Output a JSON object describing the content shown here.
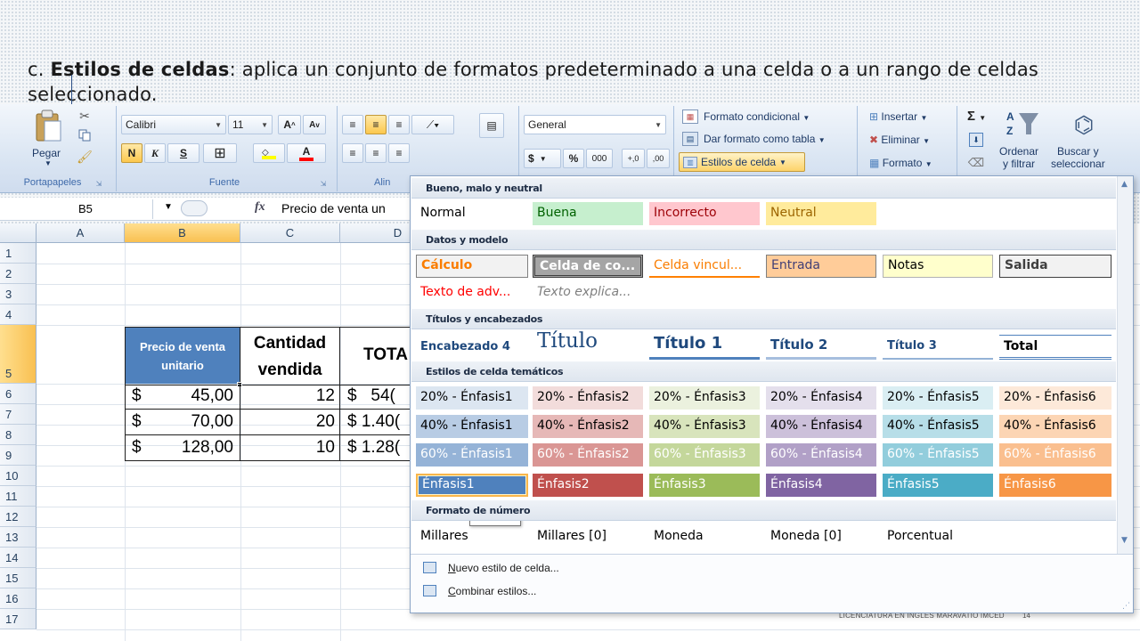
{
  "caption": {
    "prefix": "c. ",
    "bold": "Estilos de celdas",
    "rest": ": aplica un conjunto de formatos predeterminado a una celda o a un rango de celdas seleccionado."
  },
  "ribbon": {
    "clipboard": {
      "paste": "Pegar",
      "group": "Portapapeles"
    },
    "font": {
      "name": "Calibri",
      "size": "11",
      "bold": "N",
      "italic": "K",
      "underline": "S",
      "group": "Fuente"
    },
    "alignment": {
      "group": "Alin"
    },
    "number": {
      "format": "General",
      "currency": "$",
      "percent": "%",
      "thousands": "000",
      "inc_dec": "+,0",
      "dec_dec": ",00"
    },
    "styles": {
      "conditional": "Formato condicional",
      "as_table": "Dar formato como tabla",
      "cell_styles": "Estilos de celda"
    },
    "cells": {
      "insert": "Insertar",
      "delete": "Eliminar",
      "format": "Formato"
    },
    "editing": {
      "sigma": "Σ",
      "sort_1": "Ordenar",
      "sort_2": "y filtrar",
      "find_1": "Buscar y",
      "find_2": "seleccionar"
    }
  },
  "formula_bar": {
    "name_box": "B5",
    "fx": "fx",
    "content": "Precio de venta un"
  },
  "grid": {
    "columns": [
      "A",
      "B",
      "C",
      "D"
    ],
    "rows": [
      "1",
      "2",
      "3",
      "4",
      "5",
      "6",
      "7",
      "8",
      "9",
      "10",
      "11",
      "12",
      "13",
      "14",
      "15",
      "16",
      "17"
    ],
    "header_b": "Precio de venta unitario",
    "header_c_1": "Cantidad",
    "header_c_2": "vendida",
    "header_d": "TOTA",
    "data": [
      {
        "sign": "$",
        "price": "45,00",
        "qty": "12",
        "total": "$   54("
      },
      {
        "sign": "$",
        "price": "70,00",
        "qty": "20",
        "total": "$ 1.40("
      },
      {
        "sign": "$",
        "price": "128,00",
        "qty": "10",
        "total": "$ 1.28("
      }
    ],
    "footer_note": "LICENCIATURA EN INGLES MARAVATIO IMCED",
    "page_number": "14"
  },
  "panel": {
    "sections": [
      "Bueno, malo y neutral",
      "Datos y modelo",
      "Títulos y encabezados",
      "Estilos de celda temáticos",
      "Formato de número"
    ],
    "good_bad": [
      "Normal",
      "Buena",
      "Incorrecto",
      "Neutral"
    ],
    "data_model_1": [
      "Cálculo",
      "Celda de co...",
      "Celda vincul...",
      "Entrada",
      "Notas",
      "Salida"
    ],
    "data_model_2": [
      "Texto de adv...",
      "Texto explica..."
    ],
    "titles": [
      "Encabezado 4",
      "Título",
      "Título 1",
      "Título 2",
      "Título 3",
      "Total"
    ],
    "accent20": [
      "20% - Énfasis1",
      "20% - Énfasis2",
      "20% - Énfasis3",
      "20% - Énfasis4",
      "20% - Énfasis5",
      "20% - Énfasis6"
    ],
    "accent40": [
      "40% - Énfasis1",
      "40% - Énfasis2",
      "40% - Énfasis3",
      "40% - Énfasis4",
      "40% - Énfasis5",
      "40% - Énfasis6"
    ],
    "accent60": [
      "60% - Énfasis1",
      "60% - Énfasis2",
      "60% - Énfasis3",
      "60% - Énfasis4",
      "60% - Énfasis5",
      "60% - Énfasis6"
    ],
    "accent": [
      "Énfasis1",
      "Énfasis2",
      "Énfasis3",
      "Énfasis4",
      "Énfasis5",
      "Énfasis6"
    ],
    "number_formats": [
      "Millares",
      "Millares [0]",
      "Moneda",
      "Moneda [0]",
      "Porcentual"
    ],
    "tooltip": "Énfasis1",
    "new_style_key": "N",
    "new_style_rest": "uevo estilo de celda...",
    "merge_key": "C",
    "merge_rest": "ombinar estilos..."
  },
  "colors": {
    "accent1": "#4f81bd",
    "accent2": "#c0504d",
    "accent3": "#9bbb59",
    "accent4": "#8064a2",
    "accent5": "#4bacc6",
    "accent6": "#f79646",
    "header_fill": "#4f81bd"
  }
}
